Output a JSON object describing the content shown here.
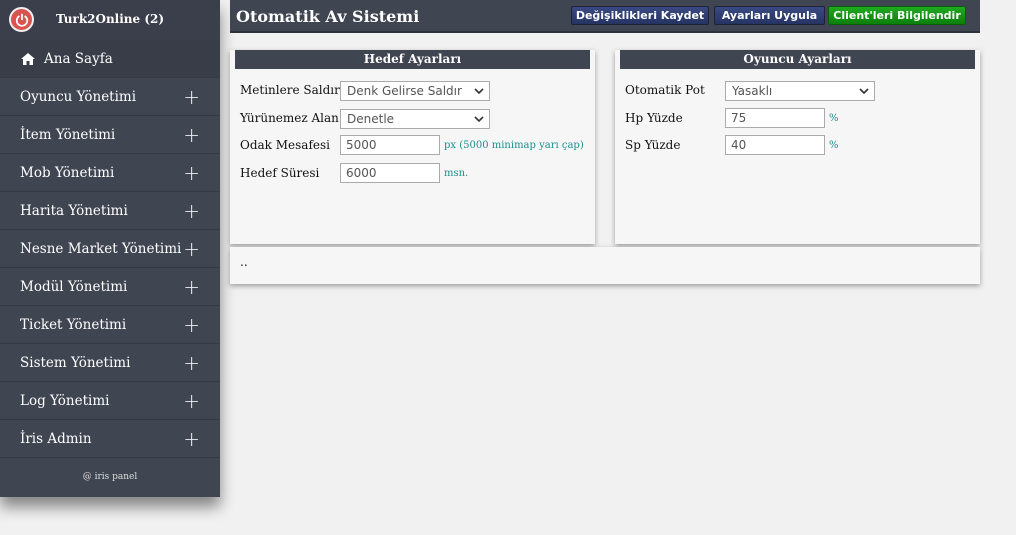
{
  "sidebar": {
    "title": "Turk2Online (2)",
    "items": [
      {
        "label": "Ana Sayfa"
      },
      {
        "label": "Oyuncu Yönetimi"
      },
      {
        "label": "İtem Yönetimi"
      },
      {
        "label": "Mob Yönetimi"
      },
      {
        "label": "Harita Yönetimi"
      },
      {
        "label": "Nesne Market Yönetimi"
      },
      {
        "label": "Modül Yönetimi"
      },
      {
        "label": "Ticket Yönetimi"
      },
      {
        "label": "Sistem Yönetimi"
      },
      {
        "label": "Log Yönetimi"
      },
      {
        "label": "İris Admin"
      }
    ],
    "expand_symbol": "+",
    "footer": "@ iris panel"
  },
  "header": {
    "title": "Otomatik Av Sistemi",
    "buttons": {
      "save": "Değişiklikleri Kaydet",
      "apply": "Ayarları Uygula",
      "notify": "Client'leri Bilgilendir"
    }
  },
  "target": {
    "title": "Hedef Ayarları",
    "attack_label": "Metinlere Saldır",
    "attack_value": "Denk Gelirse Saldır",
    "unwalkable_label": "Yürünemez Alan",
    "unwalkable_value": "Denetle",
    "focus_label": "Odak Mesafesi",
    "focus_value": "5000",
    "focus_unit": "px (5000 minimap yarı çap)",
    "duration_label": "Hedef Süresi",
    "duration_value": "6000",
    "duration_unit": "msn."
  },
  "player": {
    "title": "Oyuncu Ayarları",
    "pot_label": "Otomatik Pot",
    "pot_value": "Yasaklı",
    "hp_label": "Hp Yüzde",
    "hp_value": "75",
    "hp_unit": "%",
    "sp_label": "Sp Yüzde",
    "sp_value": "40",
    "sp_unit": "%"
  },
  "footer_note": ".."
}
